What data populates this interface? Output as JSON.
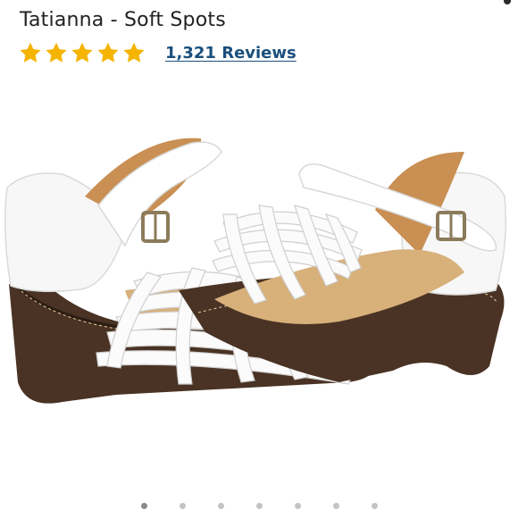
{
  "product": {
    "title": "Tatianna - Soft Spots",
    "rating_stars": 5,
    "star_color": "#f5b400",
    "reviews_label": "1,321 Reviews",
    "link_color": "#1a4f7c"
  },
  "image": {
    "description_icon": "white-huarache-sandal-pair",
    "colors": {
      "leather": "#fbfbfb",
      "heel": "#4a3324",
      "footbed": "#d7b07a"
    }
  },
  "carousel": {
    "total": 7,
    "active_index": 0
  }
}
